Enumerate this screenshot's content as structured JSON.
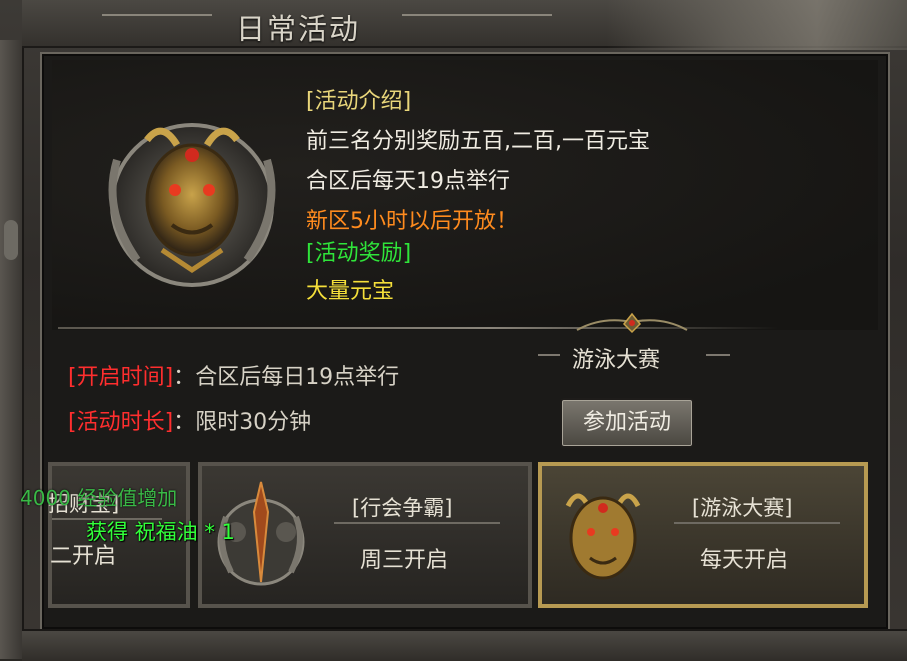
{
  "window": {
    "title": "日常活动"
  },
  "detail": {
    "intro_tag": "[活动介绍]",
    "intro_line1": "前三名分别奖励五百,二百,一百元宝",
    "intro_line2": "合区后每天19点举行",
    "open_notice": "新区5小时以后开放！",
    "reward_tag": "[活动奖励]",
    "reward_value": "大量元宝"
  },
  "schedule": {
    "open_time_label": "[开启时间]",
    "open_time_sep": "：",
    "open_time_value": "合区后每日19点举行",
    "duration_label": "[活动时长]",
    "duration_sep": "：",
    "duration_value": "限时30分钟"
  },
  "selected_event": {
    "name": "游泳大赛",
    "join_button": "参加活动"
  },
  "cards": [
    {
      "name": "[招财宝]",
      "when": "二开启",
      "partial_name": "招财宝]"
    },
    {
      "name": "[行会争霸]",
      "when": "周三开启"
    },
    {
      "name": "[游泳大赛]",
      "when": "每天开启",
      "selected": true
    }
  ],
  "notifications": {
    "line1": "4000 经验值增加",
    "line2": "获得 祝福油 * 1"
  },
  "colors": {
    "label_red": "#ff2e2e",
    "notice_orange": "#ff8b1e",
    "reward_green": "#2fe43a",
    "reward_gold": "#f5df3a",
    "selected_border": "#b79a52"
  }
}
